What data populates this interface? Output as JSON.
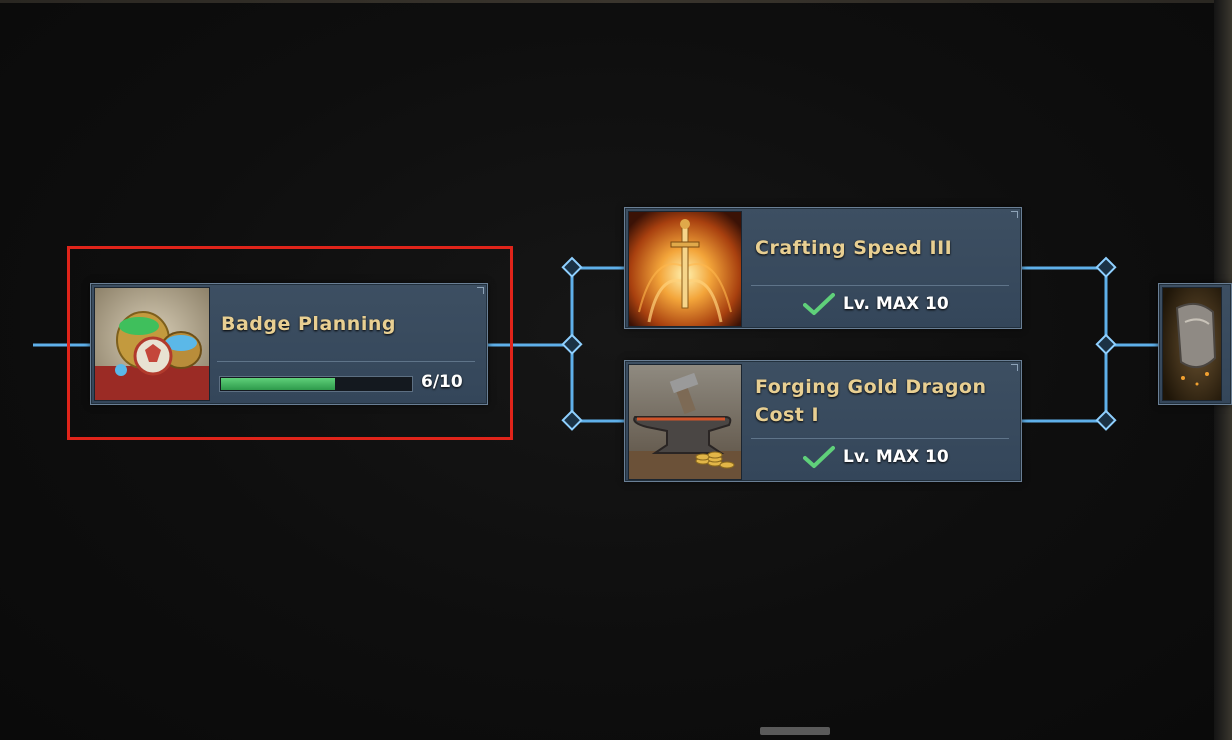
{
  "skill_tree": {
    "current_node": {
      "title": "Badge Planning",
      "progress_text": "6/10",
      "progress_fraction": 0.6,
      "icon": "badge-coins-icon",
      "highlighted": true
    },
    "branch_nodes": [
      {
        "title": "Crafting Speed III",
        "status": "Lv. MAX 10",
        "icon": "glowing-sword-icon"
      },
      {
        "title": "Forging Gold Dragon Cost I",
        "status": "Lv. MAX 10",
        "icon": "anvil-gold-icon"
      }
    ],
    "next_node": {
      "icon": "armor-partial-icon"
    }
  },
  "colors": {
    "connector": "#5fb0ea",
    "title_gold": "#e8cf92",
    "progress_green": "#4cbf68",
    "check_green": "#5fd07a",
    "highlight_red": "#e0241a",
    "card_bg": "#3b4d60"
  }
}
